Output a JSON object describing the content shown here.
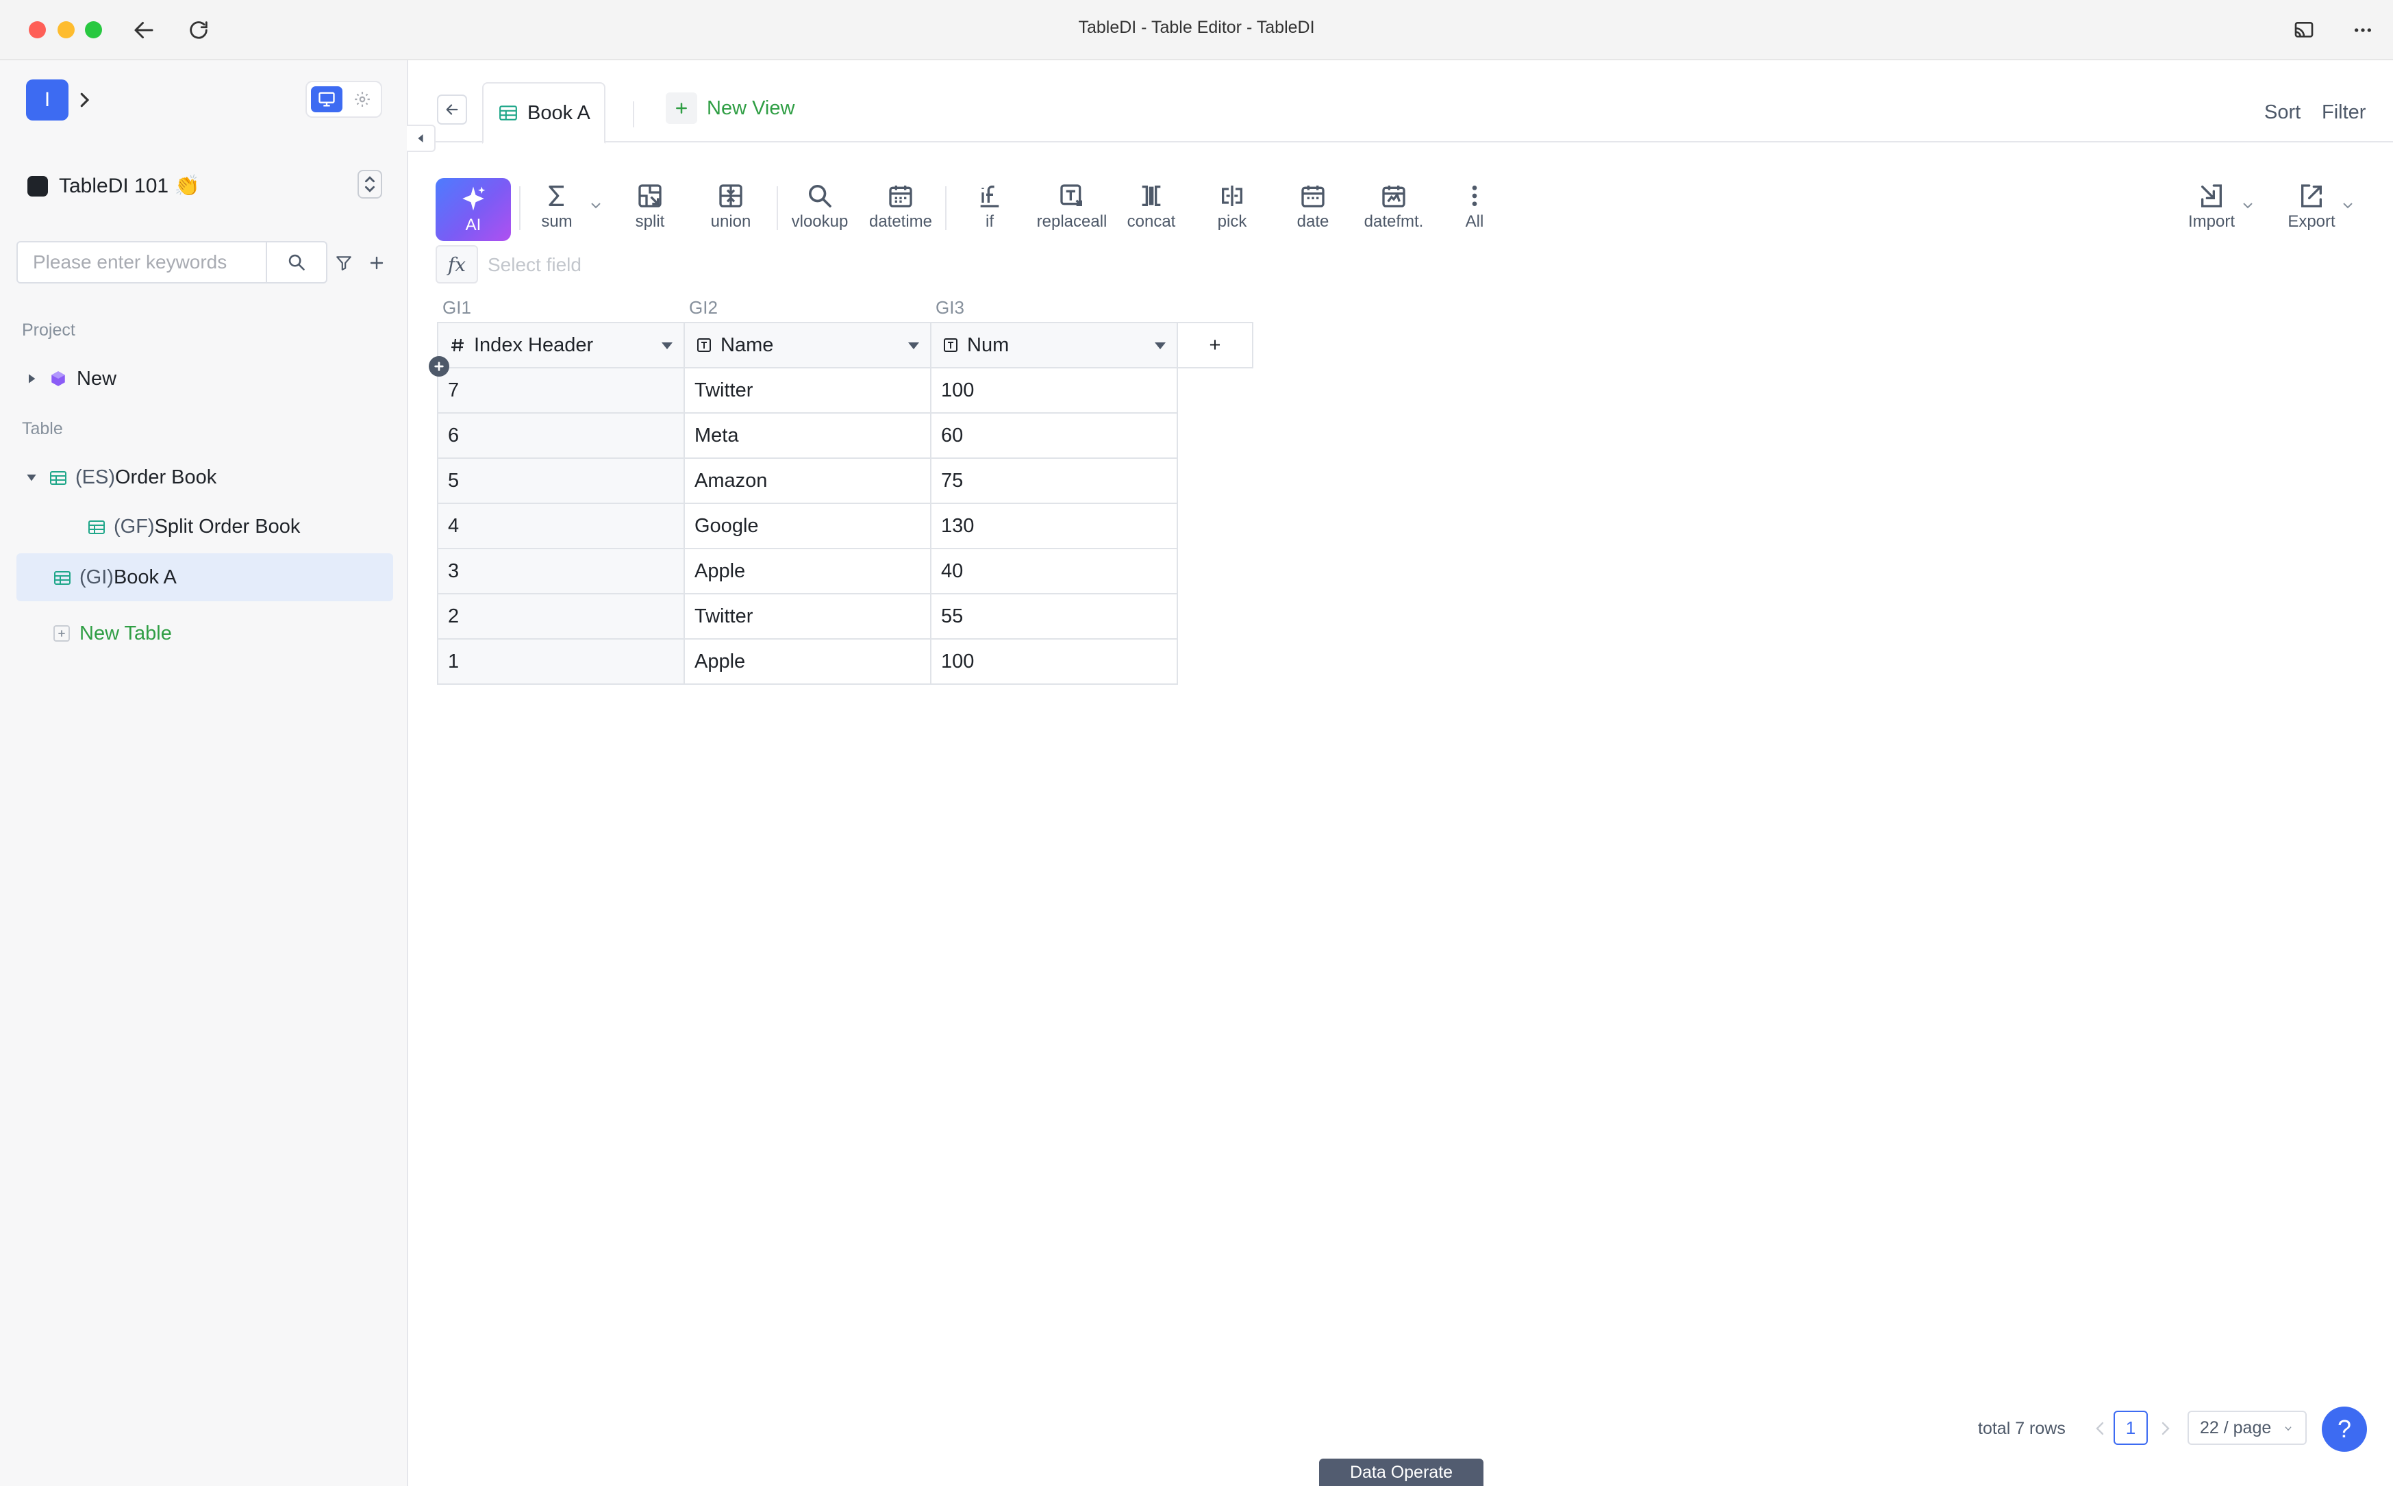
{
  "window": {
    "title": "TableDI - Table Editor - TableDI"
  },
  "workspace": {
    "avatar_letter": "I"
  },
  "project": {
    "name": "TableDI 101 👏"
  },
  "search": {
    "placeholder": "Please enter keywords",
    "value": ""
  },
  "sidebar": {
    "project_section": "Project",
    "project_items": [
      {
        "label": "New"
      }
    ],
    "table_section": "Table",
    "tables": [
      {
        "prefix": "(ES)",
        "name": "Order Book",
        "expanded": true
      },
      {
        "prefix": "(GF)",
        "name": "Split Order Book",
        "child": true
      },
      {
        "prefix": "(GI)",
        "name": "Book A",
        "selected": true
      }
    ],
    "new_table": "New Table"
  },
  "tabs": {
    "active": "Book A",
    "new_view": "New View",
    "sort": "Sort",
    "filter": "Filter"
  },
  "toolbar": {
    "ai": "AI",
    "sum": "sum",
    "split": "split",
    "union": "union",
    "vlookup": "vlookup",
    "datetime": "datetime",
    "if": "if",
    "replaceall": "replaceall",
    "concat": "concat",
    "pick": "pick",
    "date": "date",
    "datefmt": "datefmt.",
    "all": "All",
    "import": "Import",
    "export": "Export"
  },
  "formula": {
    "placeholder": "Select field",
    "value": ""
  },
  "table": {
    "groups": [
      "GI1",
      "GI2",
      "GI3"
    ],
    "columns": [
      "Index Header",
      "Name",
      "Num"
    ],
    "add_column": "+",
    "rows": [
      [
        "7",
        "Twitter",
        "100"
      ],
      [
        "6",
        "Meta",
        "60"
      ],
      [
        "5",
        "Amazon",
        "75"
      ],
      [
        "4",
        "Google",
        "130"
      ],
      [
        "3",
        "Apple",
        "40"
      ],
      [
        "2",
        "Twitter",
        "55"
      ],
      [
        "1",
        "Apple",
        "100"
      ]
    ]
  },
  "footer": {
    "total": "total 7 rows",
    "page": "1",
    "per_page": "22 / page",
    "help": "?",
    "data_operate": "Data Operate"
  },
  "colors": {
    "accent": "#3d6bf2",
    "success": "#2f9e44",
    "selected_bg": "#e4ecfa"
  }
}
